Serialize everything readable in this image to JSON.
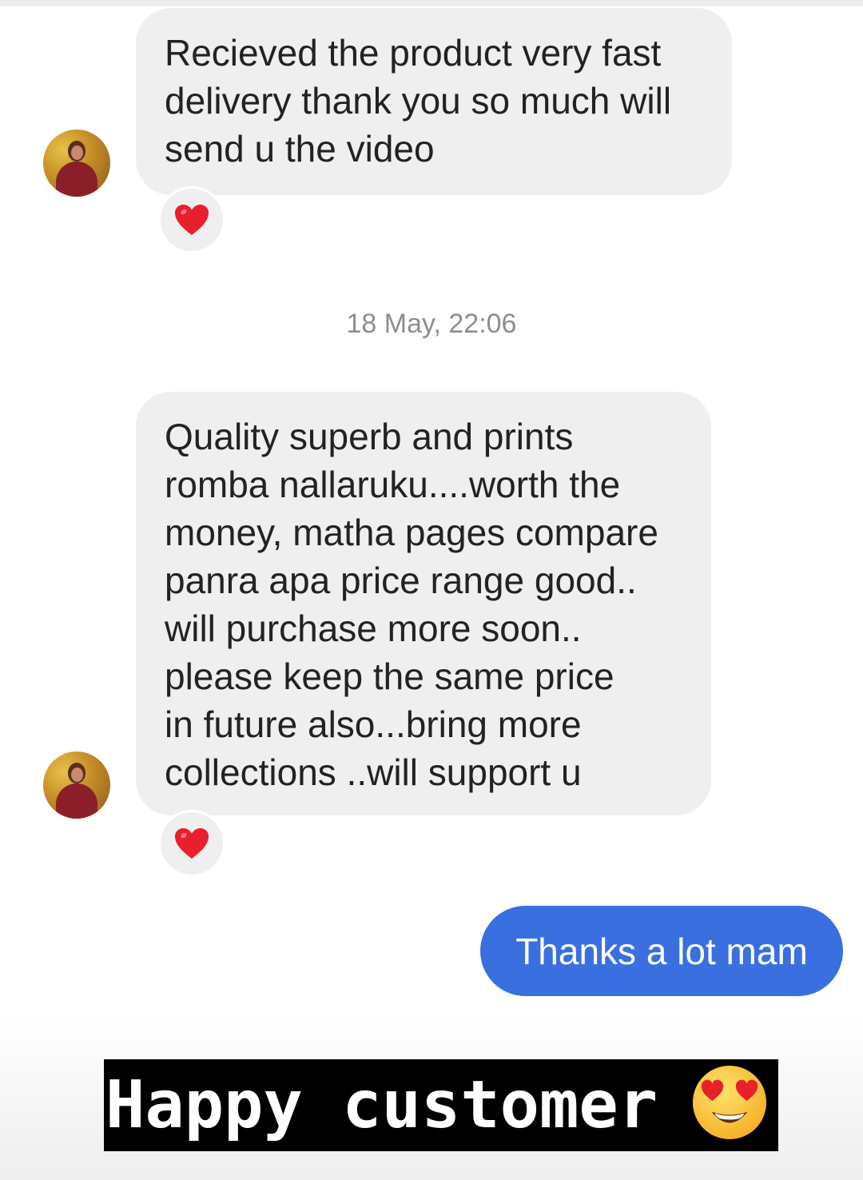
{
  "conversation": {
    "message1": {
      "lines": [
        "Recieved the product very fast",
        "delivery thank you so much will",
        "send u the video"
      ],
      "reaction": "red-heart"
    },
    "timestamp": "18 May, 22:06",
    "message2": {
      "lines": [
        "Quality superb and prints",
        "romba nallaruku....worth the",
        "money, matha pages compare",
        "panra apa price range good..",
        "will purchase more soon..",
        "please keep the same price",
        "in future also...bring more",
        "collections ..will support u"
      ],
      "reaction": "red-heart"
    },
    "reply": "Thanks a lot mam"
  },
  "caption": {
    "text": "Happy customer",
    "emoji": "heart-eyes-face"
  },
  "colors": {
    "incoming_bubble": "#efefef",
    "outgoing_bubble": "#3a6fe0",
    "heart": "#e8202c",
    "timestamp_text": "#8e8e8e",
    "caption_bg": "#000000"
  }
}
